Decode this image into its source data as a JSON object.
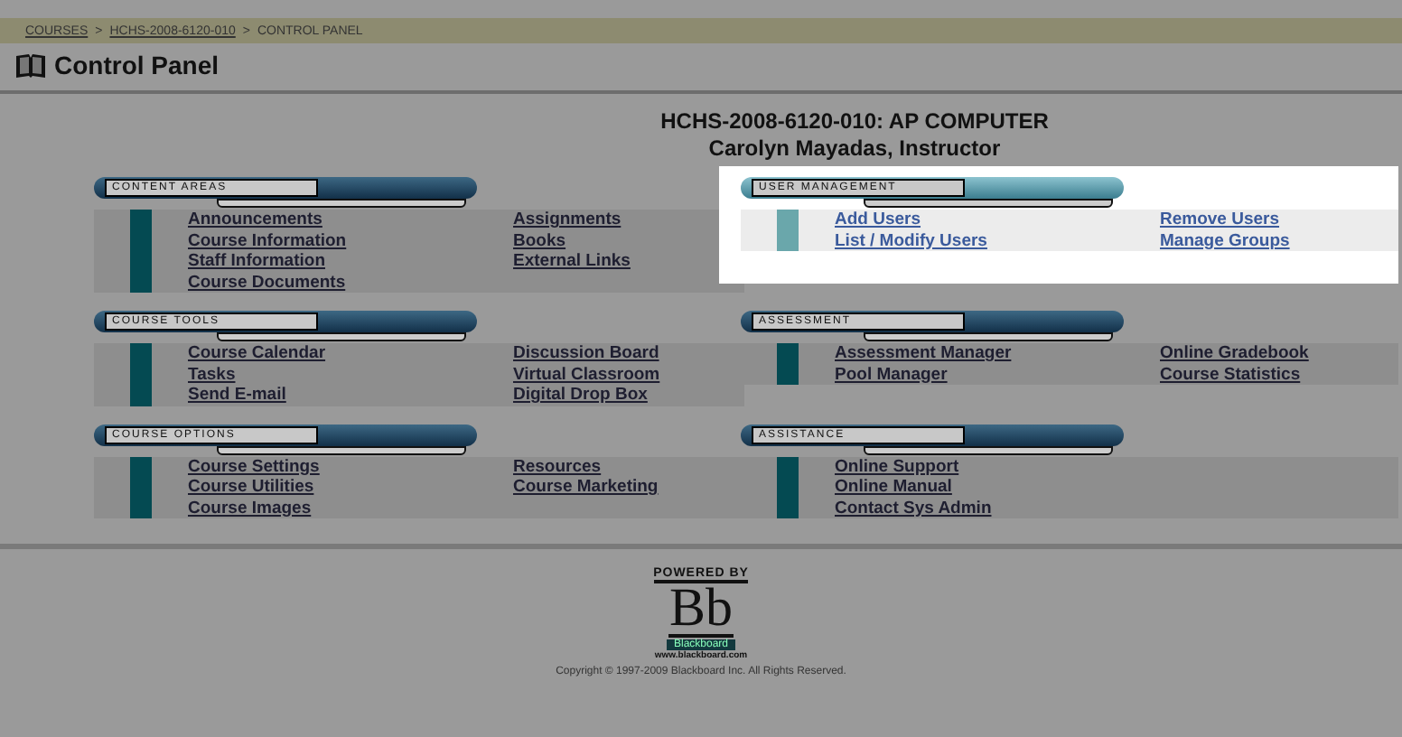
{
  "breadcrumb": [
    {
      "label": "COURSES",
      "link": true
    },
    {
      "label": ">",
      "link": false
    },
    {
      "label": "HCHS-2008-6120-010",
      "link": true
    },
    {
      "label": ">",
      "link": false
    },
    {
      "label": "CONTROL PANEL",
      "link": false
    }
  ],
  "page_title": "Control Panel",
  "course": {
    "title": "HCHS-2008-6120-010:  AP COMPUTER",
    "instructor": "Carolyn Mayadas, Instructor"
  },
  "sections": [
    {
      "title": "CONTENT AREAS",
      "highlighted": false,
      "links": [
        [
          "Announcements",
          "Course Information",
          "Staff Information",
          "Course Documents"
        ],
        [
          "Assignments",
          "Books",
          "External Links"
        ]
      ]
    },
    {
      "title": "USER MANAGEMENT",
      "highlighted": true,
      "links": [
        [
          "Add Users",
          "List / Modify Users"
        ],
        [
          "Remove Users",
          "Manage Groups"
        ]
      ]
    },
    {
      "title": "COURSE TOOLS",
      "highlighted": false,
      "links": [
        [
          "Course Calendar",
          "Tasks",
          "Send E-mail"
        ],
        [
          "Discussion Board",
          "Virtual Classroom",
          "Digital Drop Box"
        ]
      ]
    },
    {
      "title": "ASSESSMENT",
      "highlighted": false,
      "links": [
        [
          "Assessment Manager",
          "Pool Manager"
        ],
        [
          "Online Gradebook",
          "Course Statistics"
        ]
      ]
    },
    {
      "title": "COURSE OPTIONS",
      "highlighted": false,
      "links": [
        [
          "Course Settings",
          "Course Utilities",
          "Course Images"
        ],
        [
          "Resources",
          "Course Marketing"
        ]
      ]
    },
    {
      "title": "ASSISTANCE",
      "highlighted": false,
      "links": [
        [
          "Online Support",
          "Online Manual",
          "Contact Sys Admin"
        ]
      ]
    }
  ],
  "footer": {
    "powered_by": "POWERED BY",
    "logo_letters": "Bb",
    "logo_name": "Blackboard",
    "logo_url": "www.blackboard.com",
    "copyright": "Copyright © 1997-2009 Blackboard Inc. All Rights Reserved."
  }
}
